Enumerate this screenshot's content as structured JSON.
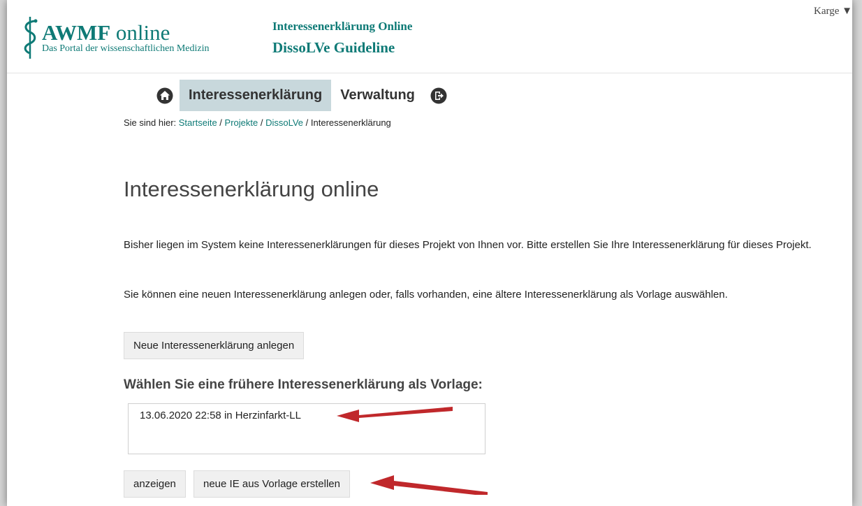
{
  "header": {
    "logo_main_bold": "AWMF",
    "logo_main_rest": " online",
    "logo_sub": "Das Portal der wissenschaftlichen Medizin",
    "title1": "Interessenerklärung Online",
    "title2": "DissoLVe Guideline",
    "user_menu": "Karge ▼"
  },
  "nav": {
    "items": [
      {
        "label": "Interessenerklärung",
        "active": true
      },
      {
        "label": "Verwaltung",
        "active": false
      }
    ],
    "icons": [
      "home-icon",
      "logout-icon"
    ]
  },
  "breadcrumb": {
    "prefix": "Sie sind hier: ",
    "links": [
      "Startseite",
      "Projekte",
      "DissoLVe"
    ],
    "separator": " / ",
    "current": "Interessenerklärung"
  },
  "main": {
    "title": "Interessenerklärung online",
    "para1": "Bisher liegen im System keine Interessenerklärungen für dieses Projekt von Ihnen vor. Bitte erstellen Sie Ihre Interessenerklärung für dieses Projekt.",
    "para2": "Sie können eine neuen Interessenerklärung anlegen oder, falls vorhanden, eine ältere Interessenerklärung als Vorlage auswählen.",
    "new_button": "Neue Interessenerklärung anlegen",
    "template_heading": "Wählen Sie eine frühere Interessenerklärung als Vorlage:",
    "template_options": [
      "13.06.2020 22:58 in Herzinfarkt-LL"
    ],
    "show_button": "anzeigen",
    "create_from_template_button": "neue IE aus Vorlage erstellen"
  },
  "colors": {
    "brand": "#0e7a76",
    "active_tab": "#c8d8dc",
    "annotation_arrow": "#c0282b"
  }
}
